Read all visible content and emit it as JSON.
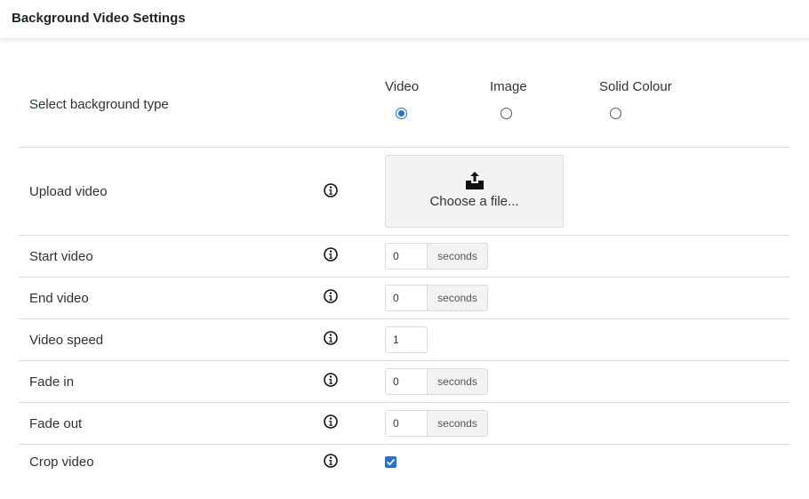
{
  "header": {
    "title": "Background Video Settings"
  },
  "background_type": {
    "label": "Select background type",
    "options": [
      {
        "label": "Video",
        "checked": true
      },
      {
        "label": "Image",
        "checked": false
      },
      {
        "label": "Solid Colour",
        "checked": false
      }
    ]
  },
  "upload": {
    "label": "Upload video",
    "button_text": "Choose a file..."
  },
  "start_video": {
    "label": "Start video",
    "value": "0",
    "unit": "seconds"
  },
  "end_video": {
    "label": "End video",
    "value": "0",
    "unit": "seconds"
  },
  "video_speed": {
    "label": "Video speed",
    "value": "1"
  },
  "fade_in": {
    "label": "Fade in",
    "value": "0",
    "unit": "seconds"
  },
  "fade_out": {
    "label": "Fade out",
    "value": "0",
    "unit": "seconds"
  },
  "crop_video": {
    "label": "Crop video",
    "checked": true
  },
  "colors": {
    "accent": "#1a73e8",
    "border": "#dcdcde",
    "addon_bg": "#f3f3f3"
  },
  "icons": {
    "info": "info-icon",
    "upload": "upload-tray-icon",
    "check": "checkmark-icon"
  }
}
